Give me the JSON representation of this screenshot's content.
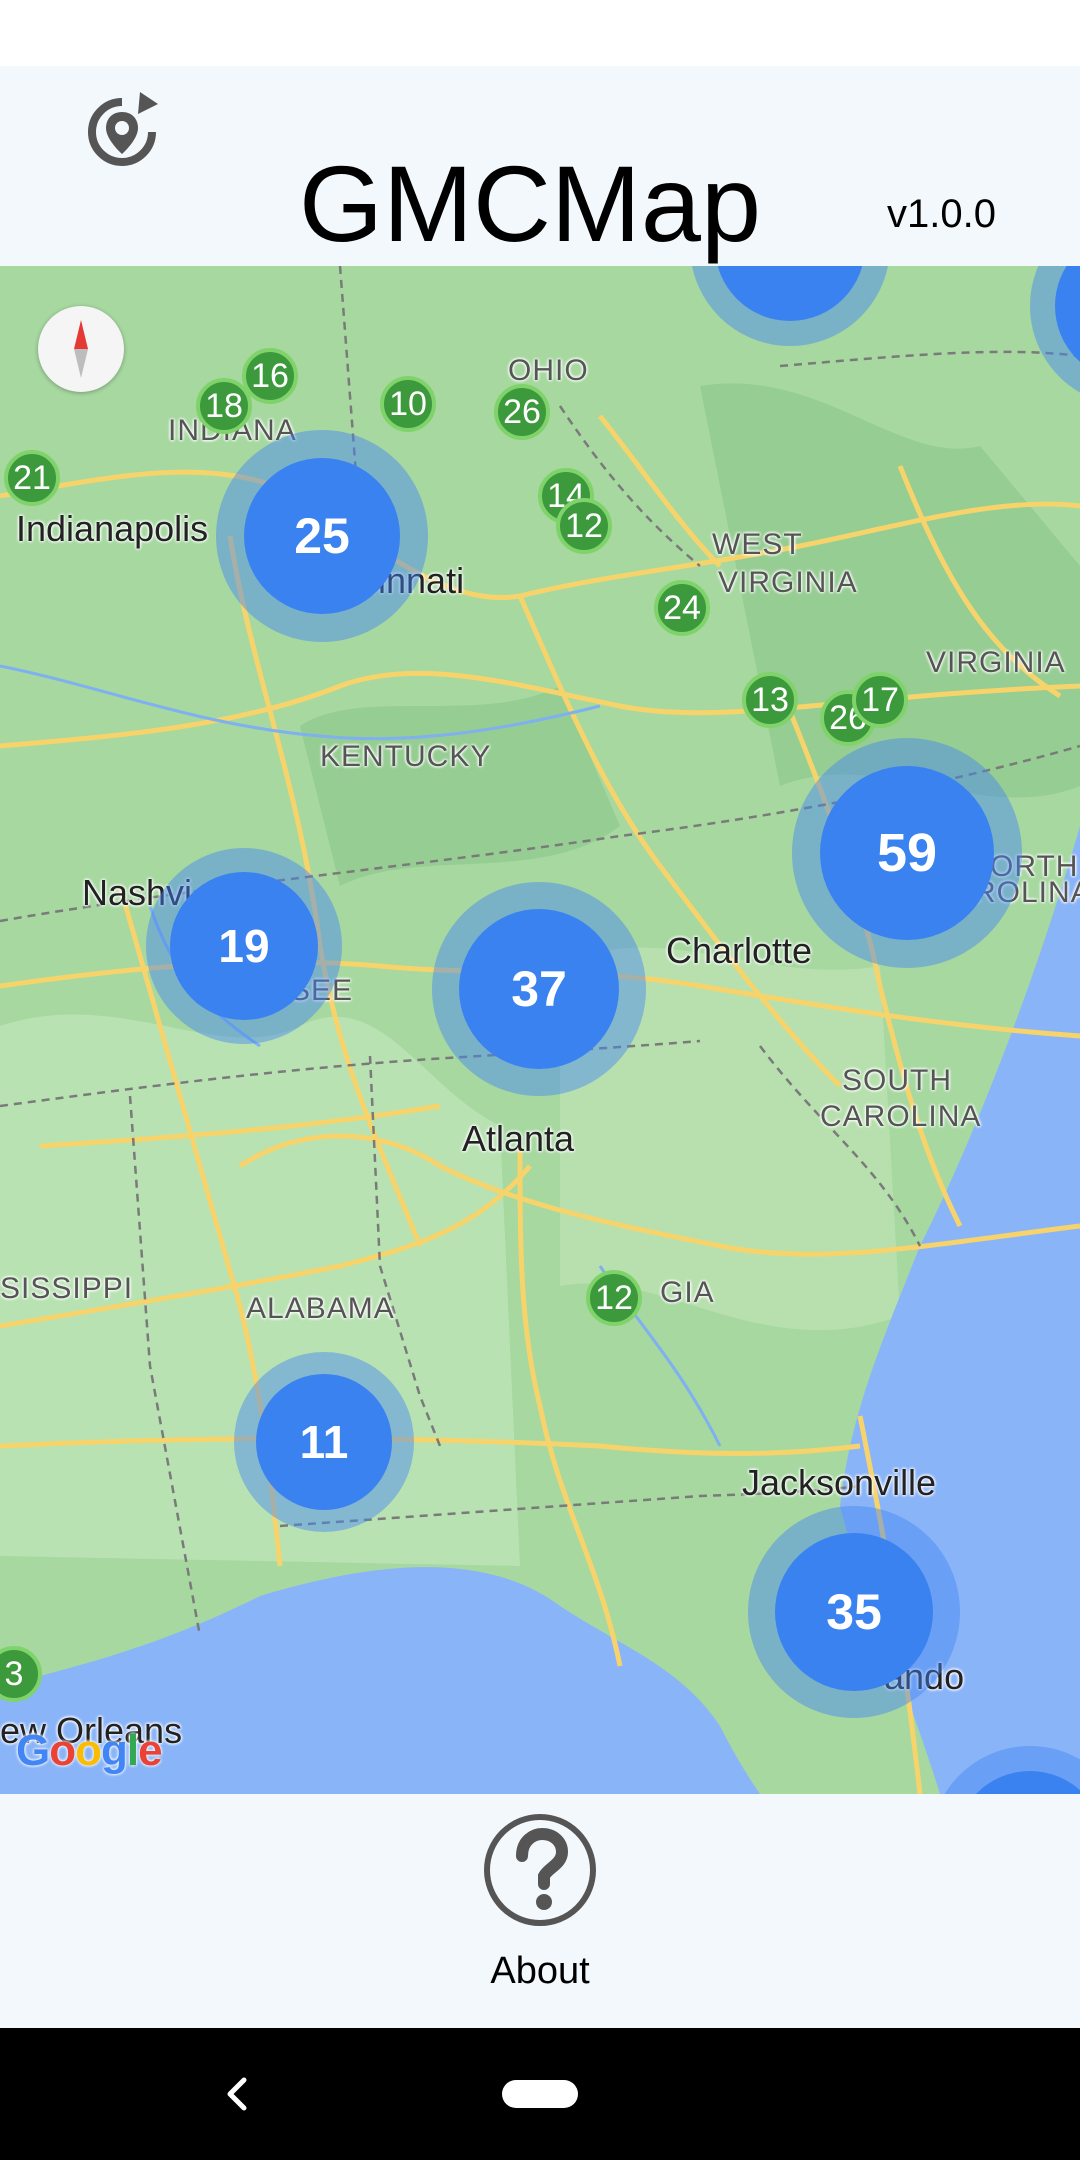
{
  "header": {
    "title": "GMCMap",
    "version": "v1.0.0",
    "reload_icon": "reload-location-icon"
  },
  "map": {
    "state_labels": [
      "OHIO",
      "INDIANA",
      "WEST",
      "VIRGINIA",
      "VIRGINIA",
      "KENTUCKY",
      "SOUTH",
      "CAROLINA",
      "ALABAMA",
      "GIA",
      "SISSIPPI",
      "ORTH",
      "ROLINA",
      "SEE"
    ],
    "city_labels": [
      "Indianapolis",
      "cinnati",
      "Nashvi",
      "Charlotte",
      "Atlanta",
      "Jacksonville",
      "ando",
      "ew Orleans"
    ],
    "clusters": [
      "25",
      "59",
      "19",
      "37",
      "11",
      "35"
    ],
    "markers": [
      "16",
      "18",
      "10",
      "26",
      "21",
      "14",
      "12",
      "24",
      "13",
      "26",
      "17",
      "12",
      "3"
    ],
    "attribution": "Google",
    "compass_icon": "compass-icon"
  },
  "bottom": {
    "about_label": "About",
    "about_icon": "help-circle-icon"
  },
  "colors": {
    "land": "#a7d7a2",
    "water": "#8ab4f8",
    "cluster": "#3a82f0",
    "marker": "#3c9a3c",
    "road": "#f9d679"
  }
}
